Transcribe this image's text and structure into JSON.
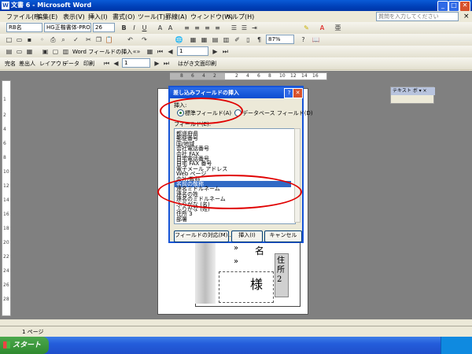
{
  "window": {
    "title": "文書 6 - Microsoft Word",
    "icon": "word-icon",
    "min": "_",
    "max": "□",
    "close": "✕"
  },
  "menu": {
    "items": [
      "ファイル(F)",
      "編集(E)",
      "表示(V)",
      "挿入(I)",
      "書式(O)",
      "ツール(T)",
      "罫線(A)",
      "ウィンドウ(W)",
      "ヘルプ(H)"
    ],
    "help_placeholder": "質問を入力してください",
    "doc_close": "×"
  },
  "toolbar1": {
    "style": "RB名",
    "font": "HG正楷書体-PRO",
    "size": "26",
    "bold": "B",
    "italic": "I",
    "underline": "U"
  },
  "toolbar2": {
    "zoom": "87%"
  },
  "toolbar3": {
    "mailmerge": "Word フィールドの挿入",
    "record": "1"
  },
  "toolbar4": {
    "items": [
      "完名",
      "差出人",
      "レイアウト",
      "データ",
      "印刷"
    ],
    "record": "1",
    "print_face": "はがき文面印刷"
  },
  "ruler": {
    "h": [
      "8",
      "6",
      "4",
      "2",
      "",
      "2",
      "4",
      "6",
      "8",
      "10",
      "12",
      "14",
      "16"
    ],
    "v": [
      "1",
      "2",
      "4",
      "6",
      "8",
      "10",
      "12",
      "14",
      "16",
      "18",
      "20",
      "22",
      "24",
      "26",
      "28"
    ]
  },
  "dialog": {
    "title": "差し込みフィールドの挿入",
    "help": "?",
    "close": "✕",
    "insert_label": "挿入:",
    "radio_standard": "標準フィールド(A)",
    "radio_database": "データベース フィールド(D)",
    "fields_label": "フィールド(E):",
    "fields": [
      "都道府県",
      "郵便番号",
      "国/地域",
      "会社電話番号",
      "会社 FAX",
      "自宅電話番号",
      "自宅 FAX 番号",
      "電子メール アドレス",
      "Web ページ",
      "会社/敬称",
      "名前の敬称",
      "連名ミドルネーム",
      "連名の姓",
      "連名のミドルネーム",
      "ふりがな (名)",
      "ふりがな (姓)",
      "住所 3",
      "部署"
    ],
    "selected_index": 10,
    "btn_match": "フィールドの対応(M)...",
    "btn_insert": "挿入(I)",
    "btn_cancel": "キャンセル"
  },
  "textbox_toolbar": {
    "title": "テキスト ボ ▾ ×"
  },
  "card": {
    "name": "名",
    "sama": "様",
    "jusho": "住所2"
  },
  "status": {
    "page": "1 ページ"
  },
  "taskbar": {
    "start": "スタート"
  },
  "colors": {
    "title_blue": "#0a5bd8",
    "selection": "#316ac5",
    "annotation_red": "#e00000"
  }
}
